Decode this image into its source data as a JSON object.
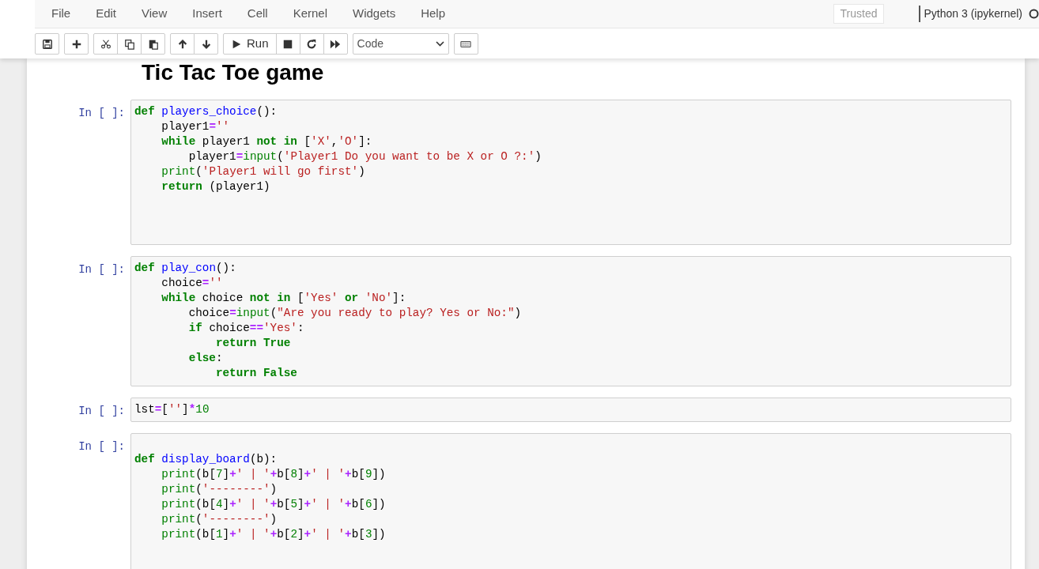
{
  "menu": [
    "File",
    "Edit",
    "View",
    "Insert",
    "Cell",
    "Kernel",
    "Widgets",
    "Help"
  ],
  "trusted": "Trusted",
  "kernel": {
    "name": "Python 3 (ipykernel)",
    "busy": false
  },
  "toolbar": [
    [
      {
        "kind": "save"
      }
    ],
    [
      {
        "kind": "insert"
      }
    ],
    [
      {
        "kind": "cut"
      },
      {
        "kind": "copy"
      },
      {
        "kind": "paste"
      }
    ],
    [
      {
        "kind": "up"
      },
      {
        "kind": "down"
      }
    ],
    [
      {
        "kind": "run",
        "label": "Run"
      },
      {
        "kind": "stop"
      },
      {
        "kind": "restart"
      },
      {
        "kind": "run-all"
      }
    ],
    [
      {
        "kind": "select",
        "value": "Code"
      }
    ],
    [
      {
        "kind": "keyboard"
      }
    ]
  ],
  "heading": "Tic Tac Toe game",
  "cells": [
    {
      "prompt": "In [ ]:",
      "lines": [
        [
          {
            "text": "def ",
            "kind": "kw"
          },
          {
            "text": "players_choice",
            "kind": "fn"
          },
          {
            "text": "():",
            "kind": "p"
          }
        ],
        [
          {
            "text": "    player1",
            "kind": "p"
          },
          {
            "text": "=",
            "kind": "op"
          },
          {
            "text": "''",
            "kind": "str"
          }
        ],
        [
          {
            "text": "    while",
            "kind": "kw"
          },
          {
            "text": " player1 ",
            "kind": "p"
          },
          {
            "text": "not in",
            "kind": "kw"
          },
          {
            "text": " [",
            "kind": "p"
          },
          {
            "text": "'X'",
            "kind": "str"
          },
          {
            "text": ",",
            "kind": "p"
          },
          {
            "text": "'O'",
            "kind": "str"
          },
          {
            "text": "]:",
            "kind": "p"
          }
        ],
        [
          {
            "text": "        player1",
            "kind": "p"
          },
          {
            "text": "=",
            "kind": "op"
          },
          {
            "text": "input",
            "kind": "bi"
          },
          {
            "text": "(",
            "kind": "p"
          },
          {
            "text": "'Player1 Do you want to be X or O ?:'",
            "kind": "str"
          },
          {
            "text": ")",
            "kind": "p"
          }
        ],
        [
          {
            "text": "    print",
            "kind": "bi"
          },
          {
            "text": "(",
            "kind": "p"
          },
          {
            "text": "'Player1 will go first'",
            "kind": "str"
          },
          {
            "text": ")",
            "kind": "p"
          }
        ],
        [
          {
            "text": "    return",
            "kind": "kw"
          },
          {
            "text": " (player1)",
            "kind": "p"
          }
        ]
      ]
    },
    {
      "prompt": "In [ ]:",
      "lines": [
        [
          {
            "text": "def ",
            "kind": "kw"
          },
          {
            "text": "play_con",
            "kind": "fn"
          },
          {
            "text": "():",
            "kind": "p"
          }
        ],
        [
          {
            "text": "    choice",
            "kind": "p"
          },
          {
            "text": "=",
            "kind": "op"
          },
          {
            "text": "''",
            "kind": "str"
          }
        ],
        [
          {
            "text": "    while",
            "kind": "kw"
          },
          {
            "text": " choice ",
            "kind": "p"
          },
          {
            "text": "not in",
            "kind": "kw"
          },
          {
            "text": " [",
            "kind": "p"
          },
          {
            "text": "'Yes' ",
            "kind": "str"
          },
          {
            "text": "or ",
            "kind": "kw"
          },
          {
            "text": "'No'",
            "kind": "str"
          },
          {
            "text": "]:",
            "kind": "p"
          }
        ],
        [
          {
            "text": "        choice",
            "kind": "p"
          },
          {
            "text": "=",
            "kind": "op"
          },
          {
            "text": "input",
            "kind": "bi"
          },
          {
            "text": "(",
            "kind": "p"
          },
          {
            "text": "\"Are you ready to play? Yes or No:\"",
            "kind": "str"
          },
          {
            "text": ")",
            "kind": "p"
          }
        ],
        [
          {
            "text": "        if",
            "kind": "kw"
          },
          {
            "text": " choice",
            "kind": "p"
          },
          {
            "text": "==",
            "kind": "op"
          },
          {
            "text": "'Yes'",
            "kind": "str"
          },
          {
            "text": ":",
            "kind": "p"
          }
        ],
        [
          {
            "text": "            return True",
            "kind": "kw"
          }
        ],
        [
          {
            "text": "        else",
            "kind": "kw"
          },
          {
            "text": ":",
            "kind": "p"
          }
        ],
        [
          {
            "text": "            return False",
            "kind": "kw"
          }
        ]
      ]
    },
    {
      "prompt": "In [ ]:",
      "lines": [
        [
          {
            "text": "lst",
            "kind": "p"
          },
          {
            "text": "=",
            "kind": "op"
          },
          {
            "text": "[",
            "kind": "p"
          },
          {
            "text": "''",
            "kind": "str"
          },
          {
            "text": "]",
            "kind": "p"
          },
          {
            "text": "*",
            "kind": "op"
          },
          {
            "text": "10",
            "kind": "num"
          }
        ]
      ]
    },
    {
      "prompt": "In [ ]:",
      "lines": [
        [
          {
            "text": "def ",
            "kind": "kw"
          },
          {
            "text": "display_board",
            "kind": "fn"
          },
          {
            "text": "(b):",
            "kind": "p"
          }
        ],
        [
          {
            "text": "    print",
            "kind": "bi"
          },
          {
            "text": "(b[",
            "kind": "p"
          },
          {
            "text": "7",
            "kind": "num"
          },
          {
            "text": "]",
            "kind": "p"
          },
          {
            "text": "+",
            "kind": "op"
          },
          {
            "text": "' | '",
            "kind": "str"
          },
          {
            "text": "+",
            "kind": "op"
          },
          {
            "text": "b[",
            "kind": "p"
          },
          {
            "text": "8",
            "kind": "num"
          },
          {
            "text": "]",
            "kind": "p"
          },
          {
            "text": "+",
            "kind": "op"
          },
          {
            "text": "' | '",
            "kind": "str"
          },
          {
            "text": "+",
            "kind": "op"
          },
          {
            "text": "b[",
            "kind": "p"
          },
          {
            "text": "9",
            "kind": "num"
          },
          {
            "text": "])",
            "kind": "p"
          }
        ],
        [
          {
            "text": "    print",
            "kind": "bi"
          },
          {
            "text": "(",
            "kind": "p"
          },
          {
            "text": "'--------'",
            "kind": "str"
          },
          {
            "text": ")",
            "kind": "p"
          }
        ],
        [
          {
            "text": "    print",
            "kind": "bi"
          },
          {
            "text": "(b[",
            "kind": "p"
          },
          {
            "text": "4",
            "kind": "num"
          },
          {
            "text": "]",
            "kind": "p"
          },
          {
            "text": "+",
            "kind": "op"
          },
          {
            "text": "' | '",
            "kind": "str"
          },
          {
            "text": "+",
            "kind": "op"
          },
          {
            "text": "b[",
            "kind": "p"
          },
          {
            "text": "5",
            "kind": "num"
          },
          {
            "text": "]",
            "kind": "p"
          },
          {
            "text": "+",
            "kind": "op"
          },
          {
            "text": "' | '",
            "kind": "str"
          },
          {
            "text": "+",
            "kind": "op"
          },
          {
            "text": "b[",
            "kind": "p"
          },
          {
            "text": "6",
            "kind": "num"
          },
          {
            "text": "])",
            "kind": "p"
          }
        ],
        [
          {
            "text": "    print",
            "kind": "bi"
          },
          {
            "text": "(",
            "kind": "p"
          },
          {
            "text": "'--------'",
            "kind": "str"
          },
          {
            "text": ")",
            "kind": "p"
          }
        ],
        [
          {
            "text": "    print",
            "kind": "bi"
          },
          {
            "text": "(b[",
            "kind": "p"
          },
          {
            "text": "1",
            "kind": "num"
          },
          {
            "text": "]",
            "kind": "p"
          },
          {
            "text": "+",
            "kind": "op"
          },
          {
            "text": "' | '",
            "kind": "str"
          },
          {
            "text": "+",
            "kind": "op"
          },
          {
            "text": "b[",
            "kind": "p"
          },
          {
            "text": "2",
            "kind": "num"
          },
          {
            "text": "]",
            "kind": "p"
          },
          {
            "text": "+",
            "kind": "op"
          },
          {
            "text": "' | '",
            "kind": "str"
          },
          {
            "text": "+",
            "kind": "op"
          },
          {
            "text": "b[",
            "kind": "p"
          },
          {
            "text": "3",
            "kind": "num"
          },
          {
            "text": "])",
            "kind": "p"
          }
        ]
      ]
    }
  ]
}
